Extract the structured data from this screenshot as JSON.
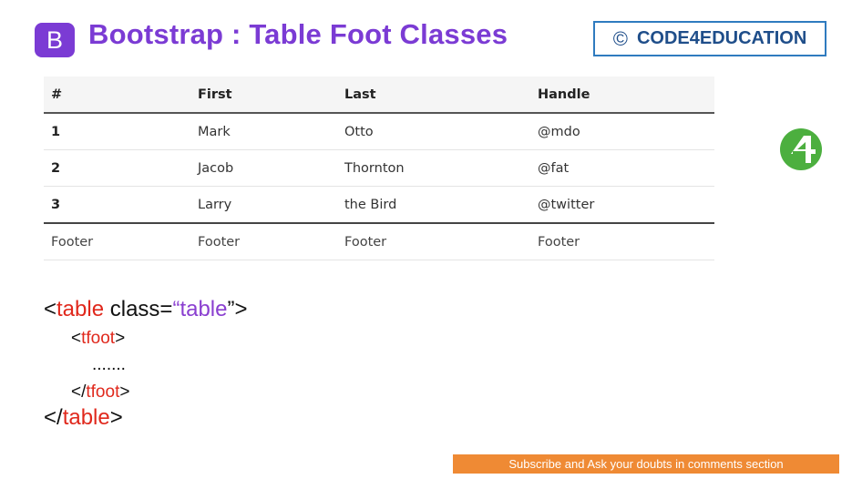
{
  "header": {
    "logo_letter": "B",
    "title": "Bootstrap : Table Foot Classes",
    "brand_symbol": "©",
    "brand_name": "CODE4EDUCATION"
  },
  "table": {
    "columns": [
      "#",
      "First",
      "Last",
      "Handle"
    ],
    "rows": [
      [
        "1",
        "Mark",
        "Otto",
        "@mdo"
      ],
      [
        "2",
        "Jacob",
        "Thornton",
        "@fat"
      ],
      [
        "3",
        "Larry",
        "the Bird",
        "@twitter"
      ]
    ],
    "footer": [
      "Footer",
      "Footer",
      "Footer",
      "Footer"
    ]
  },
  "code": {
    "open_lt": "<",
    "table_tag": "table",
    "class_attr": " class=",
    "open_quote": "“",
    "class_value": "table",
    "close_quote": "”",
    "gt": ">",
    "tfoot_tag": "tfoot",
    "ellipsis": ".......",
    "close_lt": "</"
  },
  "side_logo": {
    "icon": "code4education-logo-icon",
    "color": "#4caf3f"
  },
  "banner": {
    "text": "Subscribe and Ask your doubts in comments section"
  },
  "colors": {
    "accent": "#7b3bd4",
    "keyword": "#e0281c",
    "banner": "#ef8a34",
    "brand": "#1f4e8a"
  }
}
